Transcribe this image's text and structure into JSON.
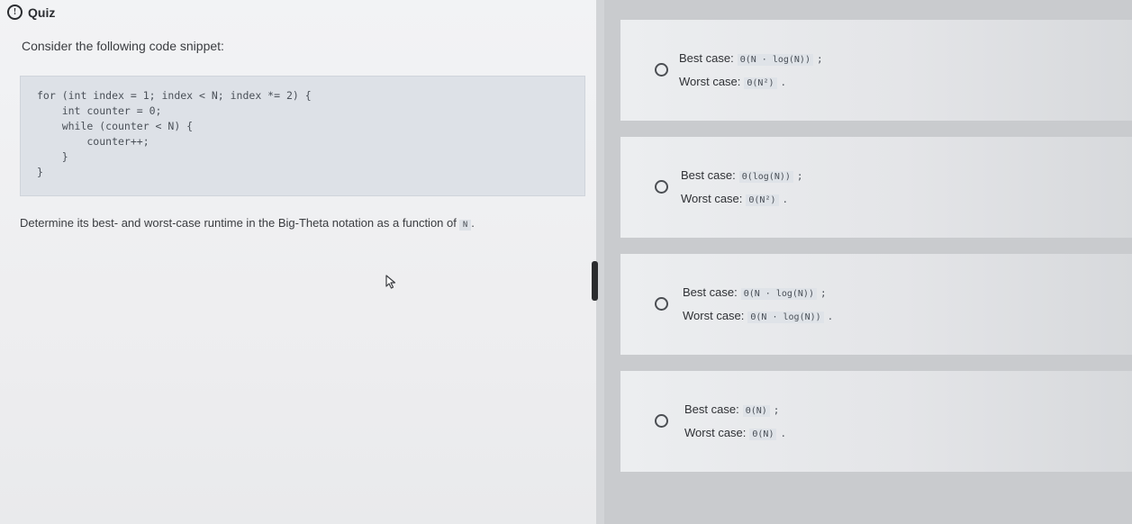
{
  "header": {
    "title": "Quiz",
    "icon": "info-circle-icon"
  },
  "question": {
    "prompt": "Consider the following code snippet:",
    "code_lines": [
      "for (int index = 1; index < N; index *= 2) {",
      "    int counter = 0;",
      "    while (counter < N) {",
      "        counter++;",
      "    }",
      "}"
    ],
    "instruction_text": "Determine its best- and worst-case runtime in the Big-Theta notation as a function of",
    "instruction_var": "N",
    "instruction_end": "."
  },
  "options": [
    {
      "best_label": "Best case:",
      "best_value": "Θ(N · log(N))",
      "best_end": ";",
      "worst_label": "Worst case:",
      "worst_value": "Θ(N²)",
      "worst_end": "."
    },
    {
      "best_label": "Best case:",
      "best_value": "Θ(log(N))",
      "best_end": ";",
      "worst_label": "Worst case:",
      "worst_value": "Θ(N²)",
      "worst_end": "."
    },
    {
      "best_label": "Best case:",
      "best_value": "Θ(N · log(N))",
      "best_end": ";",
      "worst_label": "Worst case:",
      "worst_value": "Θ(N · log(N))",
      "worst_end": "."
    },
    {
      "best_label": "Best case:",
      "best_value": "Θ(N)",
      "best_end": ";",
      "worst_label": "Worst case:",
      "worst_value": "Θ(N)",
      "worst_end": "."
    }
  ]
}
